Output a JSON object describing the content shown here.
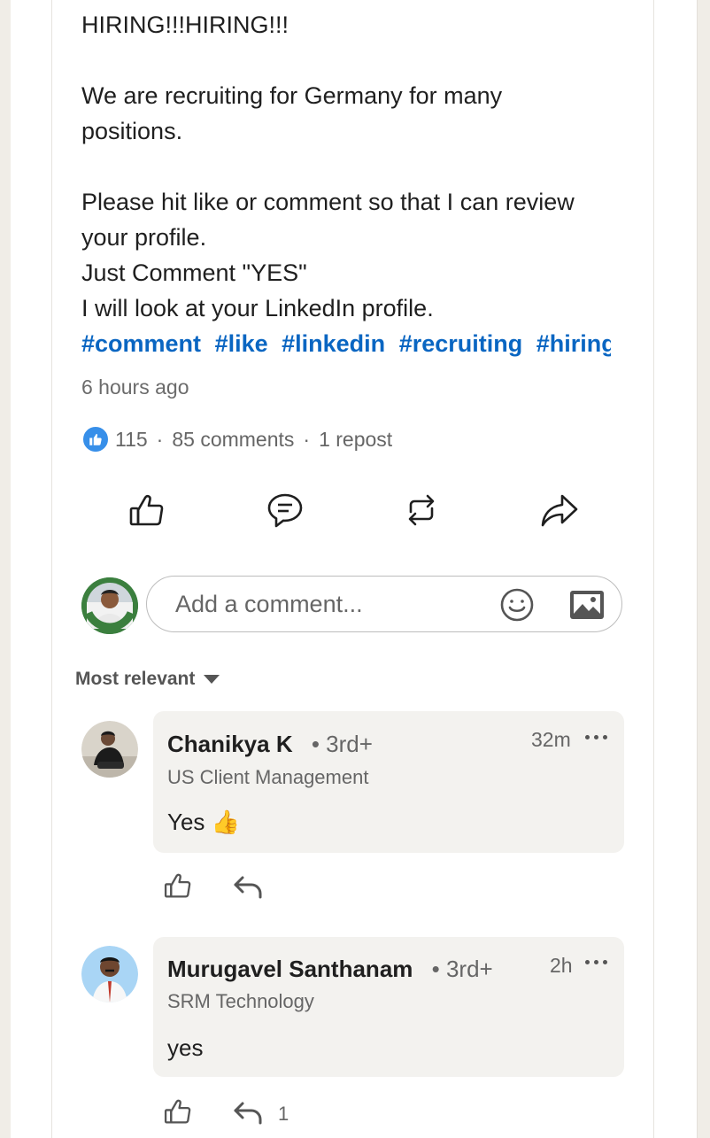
{
  "post": {
    "lines": [
      "HIRING!!!HIRING!!!",
      "",
      "We are recruiting for Germany for many",
      "positions.",
      "",
      "Please hit like or comment so that I can review",
      "your profile.",
      "Just Comment \"YES\"",
      "I will look at your LinkedIn profile."
    ],
    "hashtags": [
      "#comment",
      "#like",
      "#linkedin",
      "#recruiting",
      "#hiring"
    ],
    "timestamp": "6 hours ago",
    "stats": {
      "reactions": "115",
      "comments": "85 comments",
      "reposts": "1 repost",
      "separator": "·"
    }
  },
  "actions": [
    {
      "name": "like",
      "icon": "thumbs-up-icon"
    },
    {
      "name": "comment",
      "icon": "comment-bubble-icon"
    },
    {
      "name": "repost",
      "icon": "repost-icon"
    },
    {
      "name": "send",
      "icon": "share-arrow-icon"
    }
  ],
  "composer": {
    "placeholder": "Add a comment...",
    "avatar_badge": "OPENTOWORK"
  },
  "sort": {
    "label": "Most relevant"
  },
  "comments": [
    {
      "name": "Chanikya K",
      "degree": "• 3rd+",
      "headline": "US Client Management",
      "time": "32m",
      "text": "Yes 👍",
      "reply_count": ""
    },
    {
      "name": "Murugavel Santhanam",
      "degree": "• 3rd+",
      "headline": "SRM Technology",
      "time": "2h",
      "text": "yes",
      "reply_count": "1"
    }
  ],
  "colors": {
    "link": "#0a66c2",
    "like_badge": "#378fe9",
    "bubble": "#f3f2ef"
  }
}
